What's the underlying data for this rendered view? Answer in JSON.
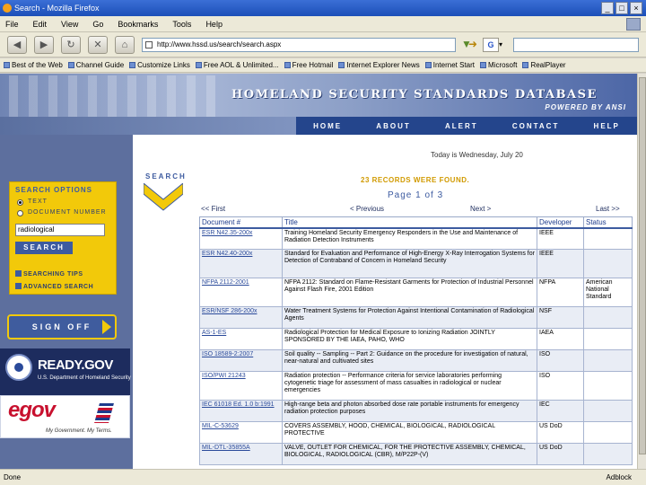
{
  "window": {
    "title": "Search - Mozilla Firefox",
    "buttons": [
      "_",
      "□",
      "×"
    ]
  },
  "menu": [
    "File",
    "Edit",
    "View",
    "Go",
    "Bookmarks",
    "Tools",
    "Help"
  ],
  "toolbar": {
    "url": "http://www.hssd.us/search/search.aspx",
    "search_engine": "G",
    "icons": [
      "back-icon",
      "forward-icon",
      "reload-icon",
      "stop-icon",
      "home-icon"
    ]
  },
  "bookmarks": [
    "Best of the Web",
    "Channel Guide",
    "Customize Links",
    "Free AOL & Unlimited...",
    "Free Hotmail",
    "Internet Explorer News",
    "Internet Start",
    "Microsoft",
    "RealPlayer"
  ],
  "site": {
    "title": "HOMELAND SECURITY STANDARDS DATABASE",
    "powered": "POWERED BY ANSI",
    "nav": [
      "HOME",
      "ABOUT",
      "ALERT",
      "CONTACT",
      "HELP"
    ],
    "today": "Today is Wednesday, July 20"
  },
  "search": {
    "heading": "SEARCH",
    "options_heading": "SEARCH OPTIONS",
    "radio_text": "TEXT",
    "radio_docnum": "DOCUMENT NUMBER",
    "query": "radiological",
    "button": "SEARCH",
    "tips": "SEARCHING TIPS",
    "advanced": "ADVANCED SEARCH"
  },
  "signoff": "SIGN OFF",
  "ready": {
    "title": "READY.GOV",
    "subtitle": "U.S. Department of Homeland Security"
  },
  "egov": {
    "title": "egov",
    "tagline": "My Government. My Terms."
  },
  "results": {
    "found": "23 RECORDS WERE FOUND.",
    "page": "Page 1 of 3",
    "first": "<< First",
    "previous": "< Previous",
    "next": "Next >",
    "last": "Last >>",
    "columns": [
      "Document #",
      "Title",
      "Developer",
      "Status"
    ],
    "rows": [
      {
        "doc": "ESR N42.35-200x",
        "title": "Training Homeland Security Emergency Responders in the Use and Maintenance of Radiation Detection Instruments",
        "dev": "IEEE",
        "status": ""
      },
      {
        "doc": "ESR N42.40-200x",
        "title": "Standard for Evaluation and Performance of High-Energy X-Ray Interrogation Systems for Detection of Contraband of Concern in Homeland Security",
        "dev": "IEEE",
        "status": ""
      },
      {
        "doc": "NFPA 2112-2001",
        "title": "NFPA 2112: Standard on Flame-Resistant Garments for Protection of Industrial Personnel Against Flash Fire, 2001 Edition",
        "dev": "NFPA",
        "status": "American National Standard"
      },
      {
        "doc": "ESR/NSF 286-200x",
        "title": "Water Treatment Systems for Protection Against Intentional Contamination of Radiological Agents",
        "dev": "NSF",
        "status": ""
      },
      {
        "doc": "AS-1-ES",
        "title": "Radiological Protection for Medical Exposure to Ionizing Radiation JOINTLY SPONSORED BY THE IAEA, PAHO, WHO",
        "dev": "IAEA",
        "status": ""
      },
      {
        "doc": "ISO 18589-2:2007",
        "title": "Soil quality -- Sampling -- Part 2: Guidance on the procedure for investigation of natural, near-natural and cultivated sites",
        "dev": "ISO",
        "status": ""
      },
      {
        "doc": "ISO/PWI 21243",
        "title": "Radiation protection -- Performance criteria for service laboratories performing cytogenetic triage for assessment of mass casualties in radiological or nuclear emergencies",
        "dev": "ISO",
        "status": ""
      },
      {
        "doc": "IEC 61018 Ed. 1.0 b:1991",
        "title": "High-range beta and photon absorbed dose rate portable instruments for emergency radiation protection purposes",
        "dev": "IEC",
        "status": ""
      },
      {
        "doc": "MIL-C-53629",
        "title": "COVERS ASSEMBLY, HOOD, CHEMICAL, BIOLOGICAL, RADIOLOGICAL PROTECTIVE",
        "dev": "US DoD",
        "status": ""
      },
      {
        "doc": "MIL-DTL-35855A",
        "title": "VALVE, OUTLET FOR CHEMICAL, FOR THE PROTECTIVE ASSEMBLY, CHEMICAL, BIOLOGICAL, RADIOLOGICAL (CBR), M/P22P-(V)",
        "dev": "US DoD",
        "status": ""
      }
    ]
  },
  "status": {
    "left": "Done",
    "right": "Adblock"
  }
}
